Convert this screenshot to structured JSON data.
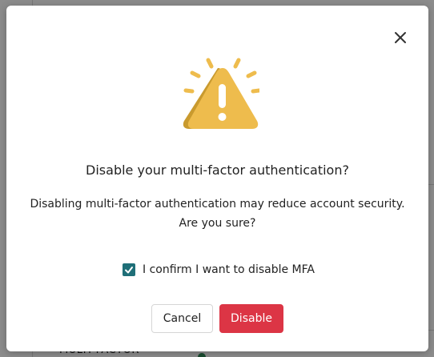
{
  "background": {
    "section_label": "MULTI-FACTOR"
  },
  "dialog": {
    "title": "Disable your multi-factor authentication?",
    "message_line1": "Disabling multi-factor authentication may reduce account security.",
    "message_line2": "Are you sure?",
    "confirm_label": "I confirm I want to disable MFA",
    "confirm_checked": true,
    "cancel_label": "Cancel",
    "disable_label": "Disable",
    "icons": {
      "close": "close-icon",
      "warning": "warning-triangle-icon",
      "check": "checkmark-icon"
    }
  },
  "colors": {
    "primary_danger": "#dc3545",
    "checkbox": "#1f6f78",
    "warning_yellow": "#eebc4d",
    "warning_shadow": "#c99a2e"
  }
}
